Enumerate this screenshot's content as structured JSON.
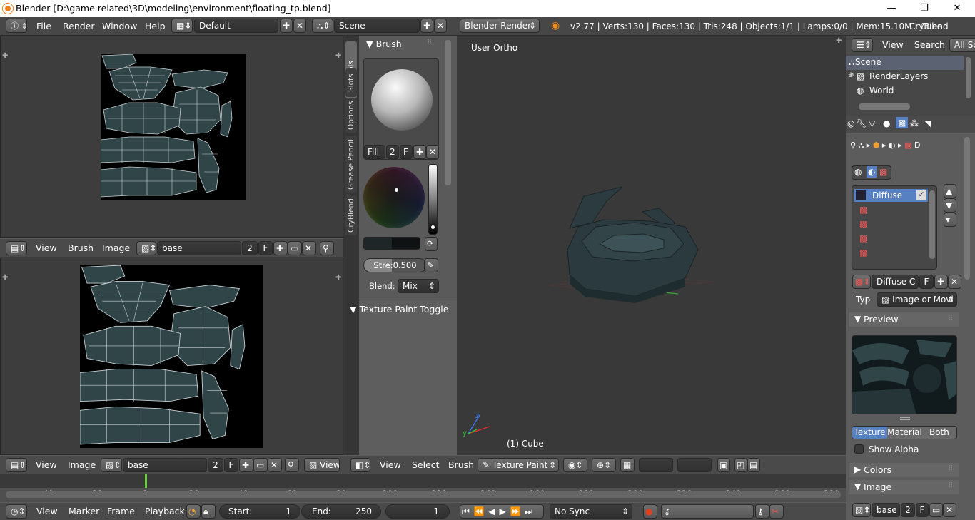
{
  "titlebar": {
    "title": "Blender [D:\\game related\\3D\\modeling\\environment\\floating_tp.blend]",
    "min": "—",
    "max": "❐",
    "close": "✕"
  },
  "infobar": {
    "menus": [
      "File",
      "Render",
      "Window",
      "Help"
    ],
    "screen_layout": "Default",
    "scene": "Scene",
    "engine": "Blender Render",
    "stats": "v2.77 | Verts:130 | Faces:130 | Tris:248 | Objects:1/1 | Lamps:0/0 | Mem:15.10M | Cube",
    "addon": "CryBlend"
  },
  "uv_top": {
    "header_menus": [
      "View",
      "Brush",
      "Image"
    ],
    "image_name": "base",
    "users": "2",
    "fake": "F"
  },
  "uv_bottom": {
    "header_menus": [
      "View",
      "Image"
    ],
    "image_name": "base",
    "users": "2",
    "fake": "F",
    "view_label": "View"
  },
  "tools": {
    "tabs": [
      "Tools",
      "Slots",
      "Options",
      "Grease Pencil",
      "CryBlend"
    ],
    "brush_header": "Brush",
    "fill_label": "Fill",
    "users": "2",
    "fake": "F",
    "strength_label": "Stre:",
    "strength_value": "0.500",
    "blend_label": "Blend:",
    "blend_value": "Mix",
    "texture_paint_toggle": "Texture Paint Toggle"
  },
  "viewport": {
    "view_name": "User Ortho",
    "object_label": "(1) Cube",
    "header_menus": [
      "View",
      "Select",
      "Brush"
    ],
    "mode": "Texture Paint"
  },
  "outliner": {
    "header_menus": [
      "View",
      "Search"
    ],
    "filter": "All Sce",
    "items": [
      "Scene",
      "RenderLayers",
      "World"
    ]
  },
  "properties": {
    "breadcrumb_last": "D",
    "slot_items": [
      "Diffuse",
      "",
      "",
      "",
      ""
    ],
    "texture_name": "Diffuse C",
    "fake": "F",
    "type_label": "Typ",
    "type_value": "Image or Movi",
    "preview_header": "Preview",
    "tabs": [
      "Texture",
      "Material",
      "Both"
    ],
    "show_alpha": "Show Alpha",
    "colors_header": "Colors",
    "image_header": "Image",
    "image_name": "base",
    "users": "2",
    "fake2": "F"
  },
  "timeline": {
    "ticks": [
      "-40",
      "-20",
      "0",
      "20",
      "40",
      "60",
      "80",
      "100",
      "120",
      "140",
      "160",
      "180",
      "200",
      "220",
      "240",
      "260",
      "280"
    ],
    "current_frame_marker": 0,
    "header_menus": [
      "View",
      "Marker",
      "Frame",
      "Playback"
    ],
    "start_label": "Start:",
    "start_value": "1",
    "end_label": "End:",
    "end_value": "250",
    "current_value": "1",
    "sync": "No Sync"
  }
}
